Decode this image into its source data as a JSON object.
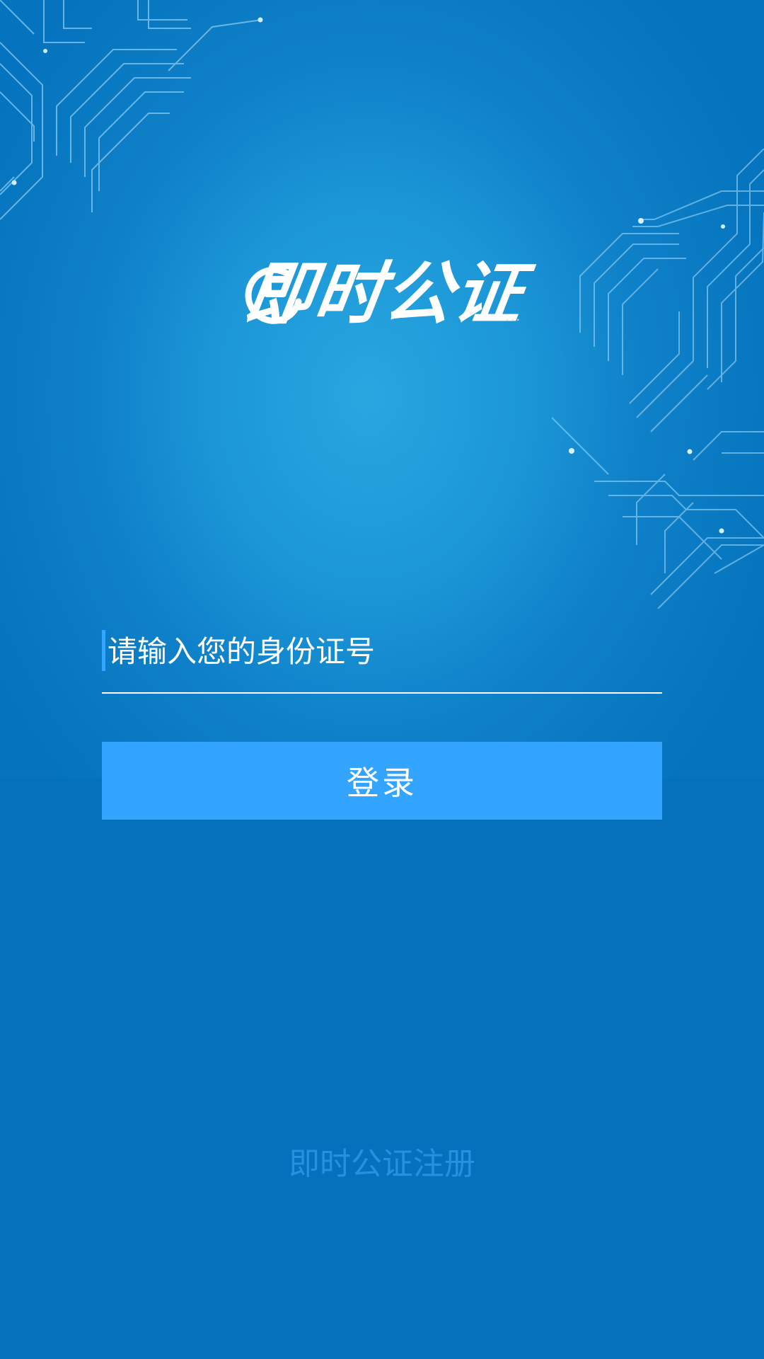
{
  "app": {
    "logo_text": "即时公证",
    "logo_mark_icon": "clock-icon"
  },
  "login_form": {
    "id_placeholder": "请输入您的身份证号",
    "id_value": "",
    "submit_label": "登录"
  },
  "footer": {
    "register_label": "即时公证注册"
  },
  "colors": {
    "background_top": "#1f9ad8",
    "background_bottom": "#0570bc",
    "button": "#33a5fe",
    "caret": "#33a6ff",
    "register_text": "#2790e2",
    "text": "#ffffff"
  }
}
